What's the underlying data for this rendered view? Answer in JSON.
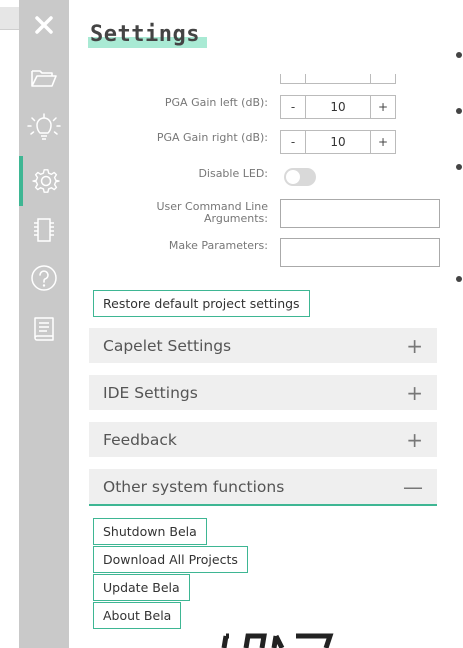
{
  "toolbar": {
    "items": [
      {
        "icon": "close-icon"
      },
      {
        "icon": "folder-open-icon"
      },
      {
        "icon": "lightbulb-icon"
      },
      {
        "icon": "gear-icon",
        "active": true
      },
      {
        "icon": "chip-icon"
      },
      {
        "icon": "help-icon"
      },
      {
        "icon": "book-icon"
      }
    ],
    "accent": "#3eb693"
  },
  "settings": {
    "title": "Settings",
    "pga_gain_left": {
      "label": "PGA Gain left (dB):",
      "value": "10",
      "minus": "-",
      "plus": "+"
    },
    "pga_gain_right": {
      "label": "PGA Gain right (dB):",
      "value": "10",
      "minus": "-",
      "plus": "+"
    },
    "disable_led": {
      "label": "Disable LED:",
      "on": false
    },
    "user_command_line": {
      "label_line1": "User Command Line",
      "label_line2": "Arguments:",
      "value": ""
    },
    "make_parameters": {
      "label": "Make Parameters:",
      "value": ""
    },
    "restore_button": "Restore default project settings"
  },
  "sections": [
    {
      "label": "Capelet Settings",
      "icon": "+",
      "expanded": false
    },
    {
      "label": "IDE Settings",
      "icon": "+",
      "expanded": false
    },
    {
      "label": "Feedback",
      "icon": "+",
      "expanded": false
    },
    {
      "label": "Other system functions",
      "icon": "—",
      "expanded": true
    }
  ],
  "system_functions": {
    "shutdown": "Shutdown Bela",
    "download": "Download All Projects",
    "update": "Update Bela",
    "about": "About Bela"
  }
}
